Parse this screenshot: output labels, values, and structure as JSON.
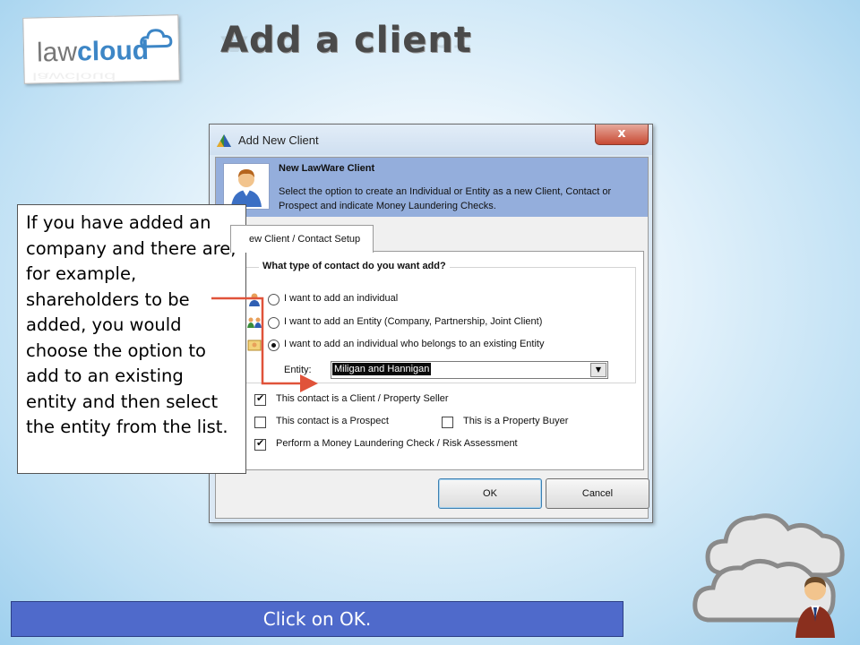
{
  "slide": {
    "title": "Add a client",
    "logo": {
      "part1": "law",
      "part2": "cloud"
    }
  },
  "dialog": {
    "title": "Add New Client",
    "close_label": "x",
    "header_title": "New LawWare Client",
    "header_desc": "Select the option to create an Individual or Entity as a new Client, Contact or Prospect and indicate Money Laundering Checks.",
    "tab_label": "ew Client / Contact Setup",
    "group_title": "What type of contact do you want add?",
    "options": [
      {
        "label": "I want to add an individual",
        "checked": false
      },
      {
        "label": "I want to add an Entity (Company, Partnership, Joint Client)",
        "checked": false
      },
      {
        "label": "I want to add an individual who belongs to an existing Entity",
        "checked": true
      }
    ],
    "entity_label": "Entity:",
    "entity_value": "Miligan and Hannigan",
    "checkboxes": {
      "client_seller": {
        "label": "This contact is a Client / Property Seller",
        "checked": true
      },
      "prospect": {
        "label": "This contact is a Prospect",
        "checked": false
      },
      "buyer": {
        "label": "This is a Property Buyer",
        "checked": false
      },
      "money_laundering": {
        "label": "Perform a Money Laundering Check / Risk Assessment",
        "checked": true
      }
    },
    "ok_label": "OK",
    "cancel_label": "Cancel"
  },
  "callout": {
    "text": "If you have added an company and there are, for example, shareholders to be added, you would choose the option to add to an existing entity and then select the entity from the list."
  },
  "footer": {
    "instruction": "Click on OK."
  },
  "colors": {
    "dialog_header": "#94aedc",
    "footer_bar": "#4f6acb",
    "arrow": "#e0533a",
    "close_button": "#c84a33"
  }
}
